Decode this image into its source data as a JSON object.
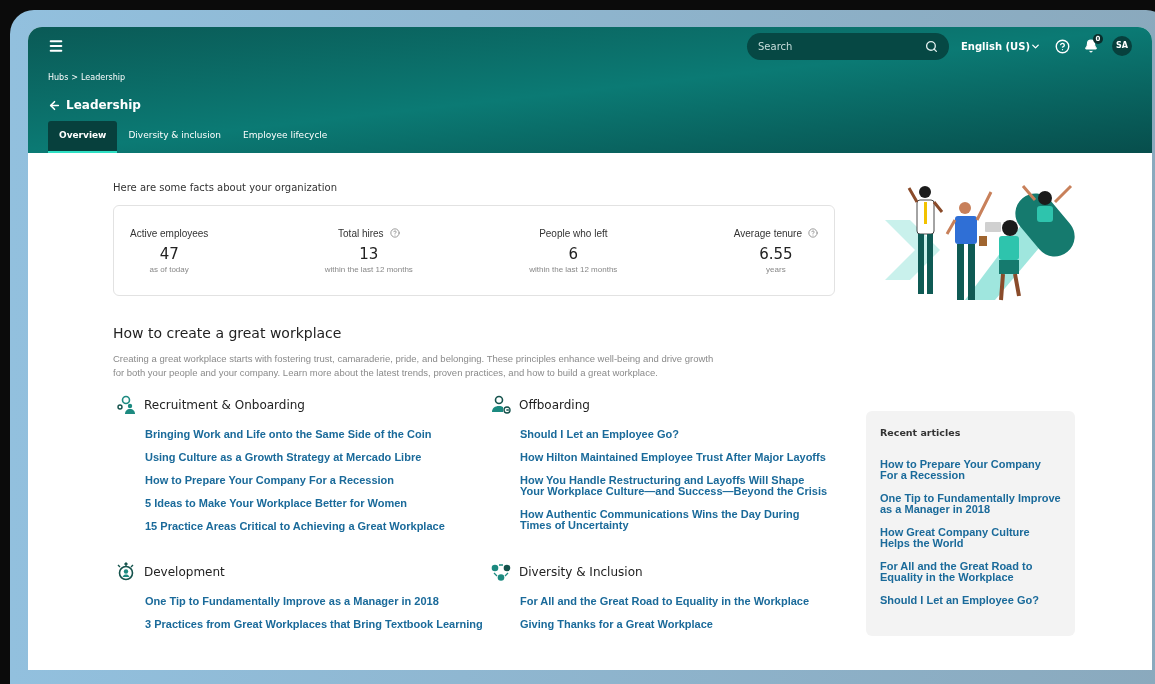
{
  "header": {
    "search": {
      "placeholder": "Search"
    },
    "language": "English (US)",
    "notifications": "0",
    "avatar": "SA"
  },
  "breadcrumb": [
    "Hubs",
    "Leadership"
  ],
  "breadcrumb_separator": ">",
  "page_title": "Leadership",
  "tabs": [
    {
      "label": "Overview",
      "selected": true
    },
    {
      "label": "Diversity & inclusion",
      "selected": false
    },
    {
      "label": "Employee lifecycle",
      "selected": false
    }
  ],
  "facts": {
    "intro": "Here are some facts about your organization",
    "stats": [
      {
        "label": "Active employees",
        "value": "47",
        "note": "as of today",
        "info_icon": false
      },
      {
        "label": "Total hires",
        "value": "13",
        "note": "within the last 12 months",
        "info_icon": true
      },
      {
        "label": "People who left",
        "value": "6",
        "note": "within the last 12 months",
        "info_icon": false
      },
      {
        "label": "Average tenure",
        "value": "6.55",
        "note": "years",
        "info_icon": true
      }
    ]
  },
  "guide": {
    "title": "How to create a great workplace",
    "description": "Creating a great workplace starts with fostering trust, camaraderie, pride, and belonging. These principles enhance well-being and drive growth for both your people and your company. Learn more about the latest trends, proven practices, and how to build a great workplace.",
    "sections": [
      {
        "kind": "recruitment",
        "title": "Recruitment & Onboarding",
        "links": [
          "Bringing Work and Life onto the Same Side of the Coin",
          "Using Culture as a Growth Strategy at Mercado Libre",
          "How to Prepare Your Company For a Recession",
          "5 Ideas to Make Your Workplace Better for Women",
          "15 Practice Areas Critical to Achieving a Great Workplace"
        ]
      },
      {
        "kind": "offboarding",
        "title": "Offboarding",
        "links": [
          "Should I Let an Employee Go?",
          "How Hilton Maintained Employee Trust After Major Layoffs",
          "How You Handle Restructuring and Layoffs Will Shape Your Workplace Culture—and Success—Beyond the Crisis",
          "How Authentic Communications Wins the Day During Times of Uncertainty"
        ]
      },
      {
        "kind": "development",
        "title": "Development",
        "links": [
          "One Tip to Fundamentally Improve as a Manager in 2018",
          "3 Practices from Great Workplaces that Bring Textbook Learning"
        ]
      },
      {
        "kind": "diversity",
        "title": "Diversity & Inclusion",
        "links": [
          "For All and the Great Road to Equality in the Workplace",
          "Giving Thanks for a Great Workplace"
        ]
      }
    ]
  },
  "recent_articles": {
    "title": "Recent articles",
    "links": [
      "How to Prepare Your Company For a Recession",
      "One Tip to Fundamentally Improve as a Manager in 2018",
      "How Great Company Culture Helps the World",
      "For All and the Great Road to Equality in the Workplace",
      "Should I Let an Employee Go?"
    ]
  }
}
